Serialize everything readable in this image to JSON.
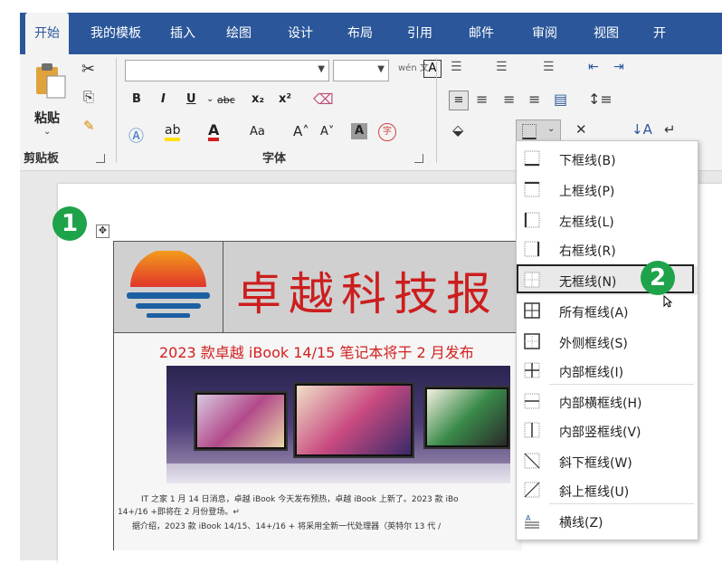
{
  "tabs": [
    "开始",
    "我的模板",
    "插入",
    "绘图",
    "设计",
    "布局",
    "引用",
    "邮件",
    "审阅",
    "视图",
    "开"
  ],
  "ribbon": {
    "clipboard": {
      "paste_label": "粘贴",
      "group_label": "剪贴板"
    },
    "font": {
      "group_label": "字体",
      "font_name": "",
      "font_size": "",
      "phonetic": "wén 文",
      "bold": "B",
      "italic": "I",
      "underline": "U",
      "strike": "abc",
      "subscript": "x₂",
      "superscript": "x²",
      "case": "Aa"
    }
  },
  "document": {
    "title": "卓越科技报",
    "headline": "2023 款卓越 iBook 14/15 笔记本将于 2 月发布",
    "para1": "IT 之家 1 月 14 日消息，卓越 iBook 今天发布预热，卓越 iBook 上新了。2023 款 iBo",
    "para2": "14+/16 +即将在 2 月份登场。↵",
    "para3": "据介绍，2023 款 iBook 14/15、14+/16 + 将采用全新一代处理器（英特尔 13 代 /"
  },
  "badges": {
    "one": "1",
    "two": "2"
  },
  "border_menu": [
    {
      "label": "下框线(B)",
      "icon": "border-bottom-icon"
    },
    {
      "label": "上框线(P)",
      "icon": "border-top-icon"
    },
    {
      "label": "左框线(L)",
      "icon": "border-left-icon"
    },
    {
      "label": "右框线(R)",
      "icon": "border-right-icon"
    },
    {
      "label": "无框线(N)",
      "icon": "border-none-icon"
    },
    {
      "label": "所有框线(A)",
      "icon": "border-all-icon"
    },
    {
      "label": "外侧框线(S)",
      "icon": "border-outside-icon"
    },
    {
      "label": "内部框线(I)",
      "icon": "border-inside-icon"
    },
    {
      "label": "内部横框线(H)",
      "icon": "border-inside-horizontal-icon"
    },
    {
      "label": "内部竖框线(V)",
      "icon": "border-inside-vertical-icon"
    },
    {
      "label": "斜下框线(W)",
      "icon": "diagonal-down-icon"
    },
    {
      "label": "斜上框线(U)",
      "icon": "diagonal-up-icon"
    },
    {
      "label": "横线(Z)",
      "icon": "horizontal-line-icon"
    }
  ],
  "colors": {
    "accent": "#2b579a",
    "title_red": "#cc1e1e",
    "badge_green": "#1fa34a"
  }
}
